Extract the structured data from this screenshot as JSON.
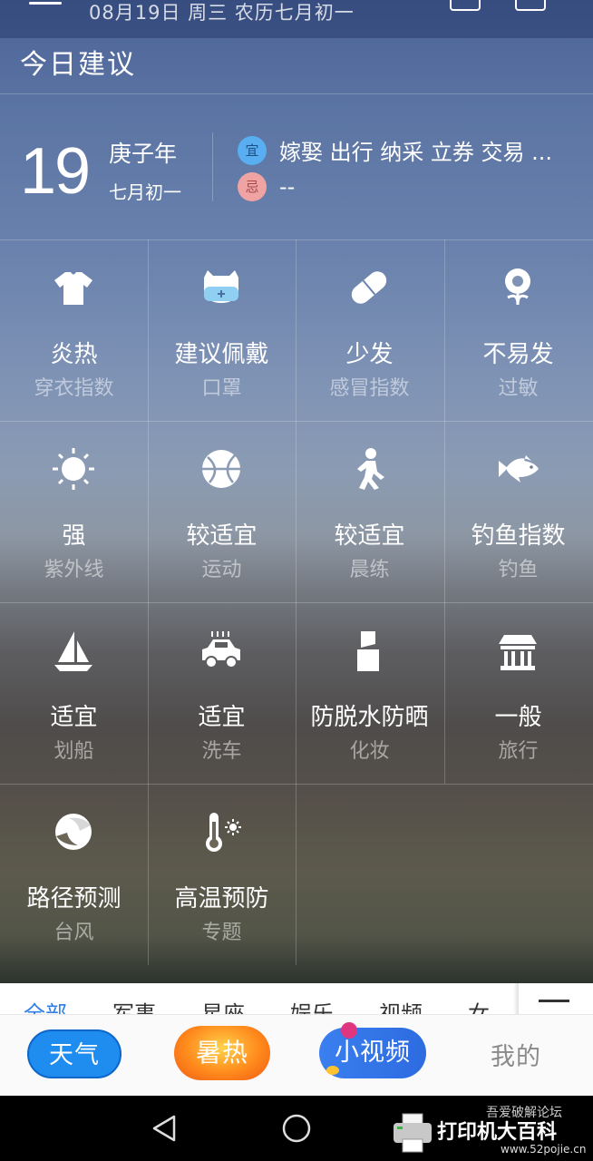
{
  "status": {
    "date_line": "08月19日 周三 农历七月初一"
  },
  "section": {
    "title": "今日建议"
  },
  "almanac": {
    "day": "19",
    "lunar_year": "庚子年",
    "lunar_month": "七月初一",
    "yi_label": "宜",
    "yi_text": "嫁娶 出行 纳采 立券 交易 ...",
    "ji_label": "忌",
    "ji_text": "--"
  },
  "indices": [
    {
      "icon": "tshirt-icon",
      "value": "炎热",
      "label": "穿衣指数"
    },
    {
      "icon": "mask-icon",
      "value": "建议佩戴",
      "label": "口罩"
    },
    {
      "icon": "pill-icon",
      "value": "少发",
      "label": "感冒指数"
    },
    {
      "icon": "flower-icon",
      "value": "不易发",
      "label": "过敏"
    },
    {
      "icon": "sun-icon",
      "value": "强",
      "label": "紫外线"
    },
    {
      "icon": "ball-icon",
      "value": "较适宜",
      "label": "运动"
    },
    {
      "icon": "runner-icon",
      "value": "较适宜",
      "label": "晨练"
    },
    {
      "icon": "fish-icon",
      "value": "钓鱼指数",
      "label": "钓鱼"
    },
    {
      "icon": "sailboat-icon",
      "value": "适宜",
      "label": "划船"
    },
    {
      "icon": "car-wash-icon",
      "value": "适宜",
      "label": "洗车"
    },
    {
      "icon": "cosmetics-icon",
      "value": "防脱水防晒",
      "label": "化妆"
    },
    {
      "icon": "pavilion-icon",
      "value": "一般",
      "label": "旅行"
    },
    {
      "icon": "typhoon-icon",
      "value": "路径预测",
      "label": "台风"
    },
    {
      "icon": "thermometer-icon",
      "value": "高温预防",
      "label": "专题"
    }
  ],
  "news_tabs": [
    "全部",
    "军事",
    "星座",
    "娱乐",
    "视频",
    "女"
  ],
  "bottom_nav": {
    "weather": "天气",
    "heat": "暑热",
    "video": "小视频",
    "mine": "我的"
  },
  "watermark": {
    "top": "吾爱破解论坛",
    "main": "打印机大百科",
    "url": "www.52pojie.cn"
  },
  "colors": {
    "accent": "#1f8cf0",
    "yi_badge": "#58aef0",
    "ji_badge": "#f0a3a3",
    "heat_badge": "#ff8a1c"
  }
}
